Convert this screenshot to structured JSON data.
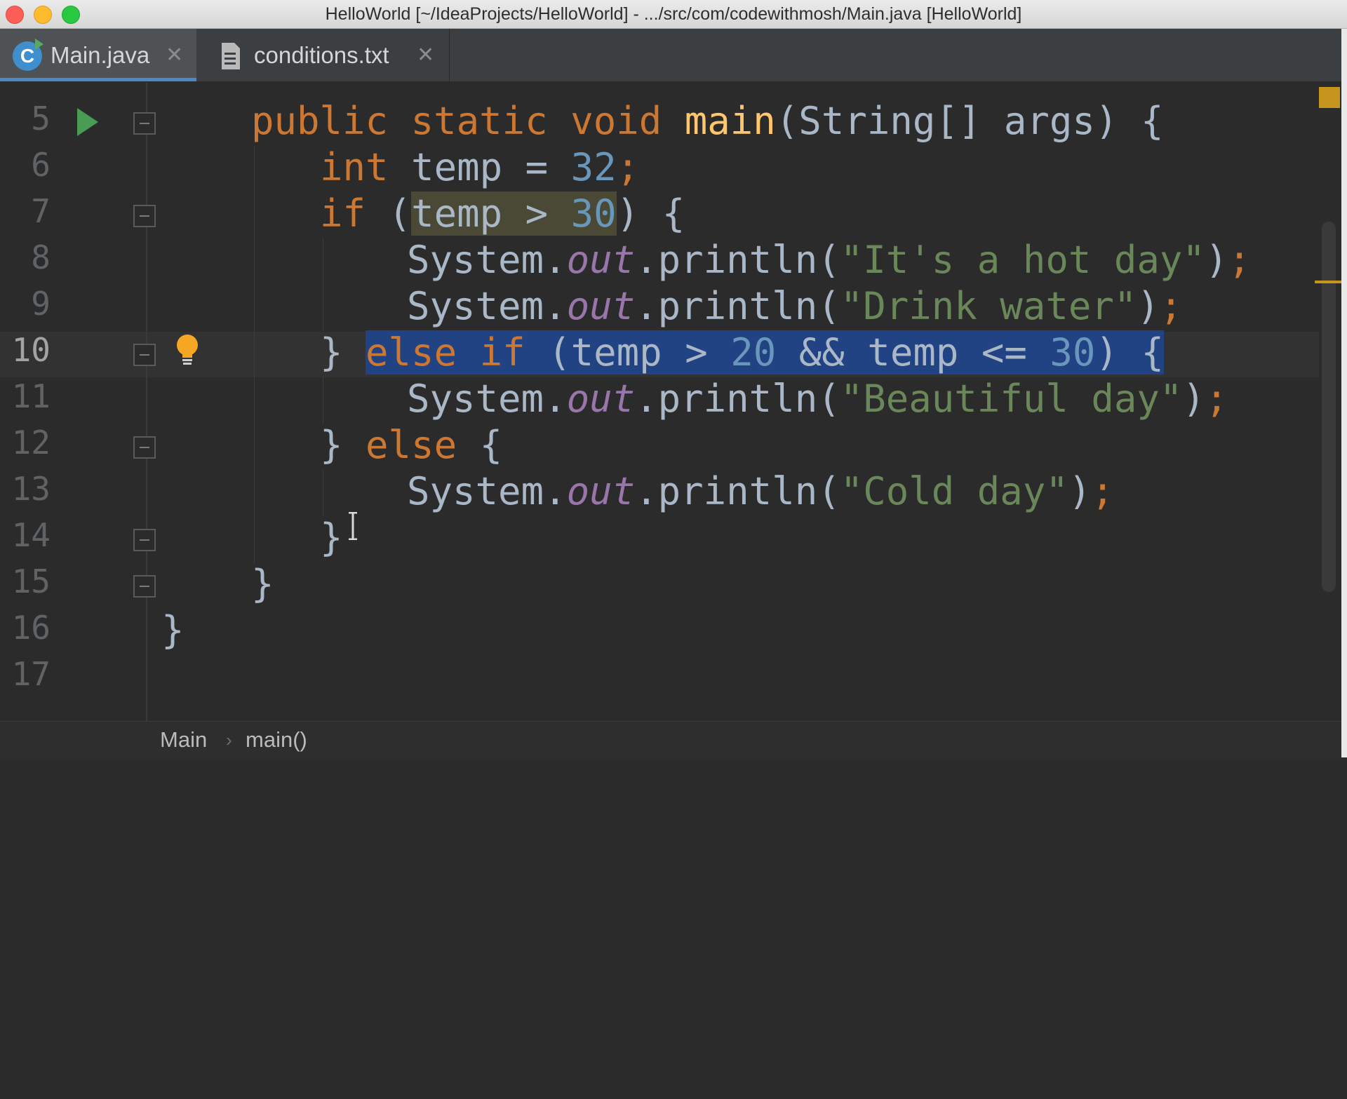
{
  "window": {
    "title": "HelloWorld [~/IdeaProjects/HelloWorld] - .../src/com/codewithmosh/Main.java [HelloWorld]"
  },
  "tabs": [
    {
      "label": "Main.java",
      "icon": "class-icon",
      "icon_letter": "C",
      "active": true,
      "close": "✕"
    },
    {
      "label": "conditions.txt",
      "icon": "text-file-icon",
      "active": false,
      "close": "✕"
    }
  ],
  "editor": {
    "current_line": 10,
    "lines": [
      {
        "num": "5"
      },
      {
        "num": "6"
      },
      {
        "num": "7"
      },
      {
        "num": "8"
      },
      {
        "num": "9"
      },
      {
        "num": "10"
      },
      {
        "num": "11"
      },
      {
        "num": "12"
      },
      {
        "num": "13"
      },
      {
        "num": "14"
      },
      {
        "num": "15"
      },
      {
        "num": "16"
      },
      {
        "num": "17"
      }
    ],
    "code": {
      "l5": {
        "public": "public",
        "static": "static",
        "void": "void",
        "main": "main",
        "rest": "(String[] args) {"
      },
      "l6": {
        "int": "int",
        "mid": " temp = ",
        "num": "32",
        "semi": ";"
      },
      "l7": {
        "if": "if",
        "open": " (",
        "cond_a": "temp > ",
        "cond_num": "30",
        "close": ") {"
      },
      "l8": {
        "sys": "System.",
        "out": "out",
        "call": ".println(",
        "str": "\"It's a hot day\"",
        "end": ")",
        "semi": ";"
      },
      "l9": {
        "sys": "System.",
        "out": "out",
        "call": ".println(",
        "str": "\"Drink water\"",
        "end": ")",
        "semi": ";"
      },
      "l10": {
        "brace": "} ",
        "else": "else",
        "sp": " ",
        "if": "if",
        "a": " (temp > ",
        "n1": "20",
        "b": " && temp <= ",
        "n2": "30",
        "c": ") {"
      },
      "l11": {
        "sys": "System.",
        "out": "out",
        "call": ".println(",
        "str": "\"Beautiful day\"",
        "end": ")",
        "semi": ";"
      },
      "l12": {
        "brace": "} ",
        "else": "else",
        "rest": " {"
      },
      "l13": {
        "sys": "System.",
        "out": "out",
        "call": ".println(",
        "str": "\"Cold day\"",
        "end": ")",
        "semi": ";"
      },
      "l14": {
        "brace": "}"
      },
      "l15": {
        "brace": "}"
      },
      "l16": {
        "brace": "}"
      }
    }
  },
  "breadcrumb": {
    "items": [
      "Main",
      "main()"
    ],
    "separator": "›"
  },
  "colors": {
    "keyword": "#cc7832",
    "function": "#ffc66d",
    "number": "#6897bb",
    "string": "#6a8759",
    "field": "#9876aa",
    "selection": "#214283",
    "tab_underline": "#4a88c7"
  }
}
